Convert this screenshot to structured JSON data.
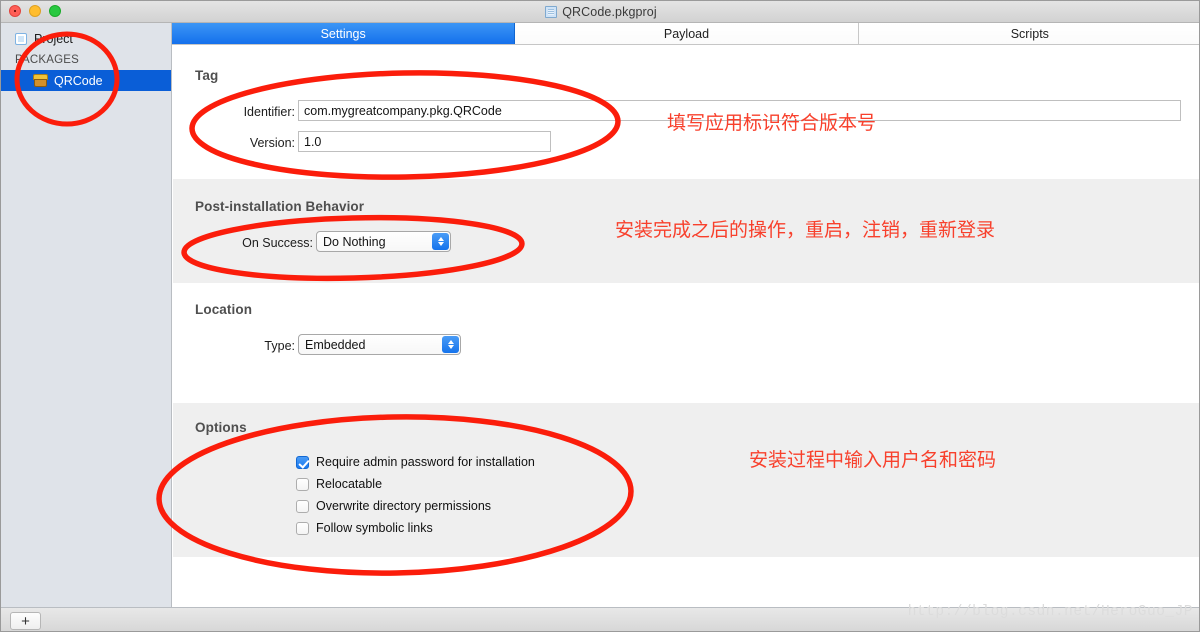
{
  "window": {
    "title": "QRCode.pkgproj",
    "traffic_lights": [
      "close-button",
      "minimize-button",
      "zoom-button"
    ]
  },
  "sidebar": {
    "project_label": "Project",
    "section_header": "PACKAGES",
    "packages": [
      {
        "label": "QRCode",
        "selected": true
      }
    ]
  },
  "tabs": [
    {
      "label": "Settings",
      "active": true
    },
    {
      "label": "Payload",
      "active": false
    },
    {
      "label": "Scripts",
      "active": false
    }
  ],
  "sections": {
    "tag": {
      "title": "Tag",
      "identifier_label": "Identifier:",
      "identifier_value": "com.mygreatcompany.pkg.QRCode",
      "version_label": "Version:",
      "version_value": "1.0"
    },
    "post_install": {
      "title": "Post-installation Behavior",
      "on_success_label": "On Success:",
      "on_success_value": "Do Nothing"
    },
    "location": {
      "title": "Location",
      "type_label": "Type:",
      "type_value": "Embedded"
    },
    "options": {
      "title": "Options",
      "items": [
        {
          "label": "Require admin password for installation",
          "checked": true
        },
        {
          "label": "Relocatable",
          "checked": false
        },
        {
          "label": "Overwrite directory permissions",
          "checked": false
        },
        {
          "label": "Follow symbolic links",
          "checked": false
        }
      ]
    }
  },
  "bottom_bar": {
    "add_label": "+",
    "watermark": "http://blog.csdn.net/HeroGuo_JP"
  },
  "annotations": [
    {
      "text": "填写应用标识符合版本号"
    },
    {
      "text": "安装完成之后的操作，重启，注销，重新登录"
    },
    {
      "text": "安装过程中输入用户名和密码"
    }
  ],
  "colors": {
    "accent_blue": "#1470ec",
    "selection_blue": "#0a5ed7",
    "annotation_red": "#f8402c",
    "panel_gray": "#efefef",
    "sidebar_gray": "#dfe3e9"
  }
}
